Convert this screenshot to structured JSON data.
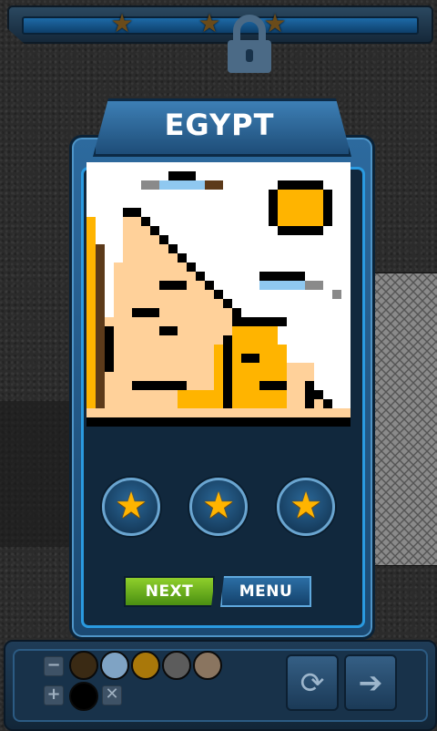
{
  "progress": {
    "stars": [
      "★",
      "★",
      "★"
    ],
    "star_color": "#6a4b1a"
  },
  "dialog": {
    "title": "EGYPT",
    "stars": [
      "★",
      "★",
      "★"
    ],
    "star_color": "#ffb400",
    "next_label": "NEXT",
    "menu_label": "MENU",
    "picture_colors": {
      "sky": "#ffffff",
      "outline": "#000000",
      "pyramid": "#ffd19a",
      "sphinx": "#ffb400",
      "sun": "#ffb400",
      "cloud": "#8fc8f0",
      "stone": "#5c3a1a",
      "shade": "#8a8a8a"
    }
  },
  "toolbar": {
    "minus_label": "−",
    "plus_label": "+",
    "clear_label": "✕",
    "swatches": [
      "#3a2a14",
      "#7fa3c4",
      "#a9780a",
      "#5c5c5c",
      "#8a7560",
      "#000000"
    ],
    "lock_icon": "lock-icon",
    "rotate_icon": "rotate-icon",
    "exit_icon": "exit-icon",
    "rotate_glyph": "⟳",
    "exit_glyph": "➔"
  }
}
